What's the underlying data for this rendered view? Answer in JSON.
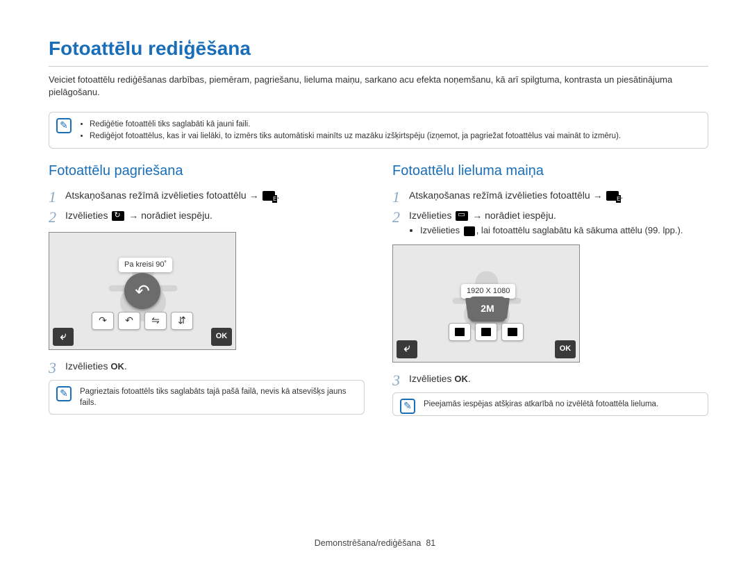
{
  "title": "Fotoattēlu rediģēšana",
  "intro": "Veiciet fotoattēlu rediģēšanas darbības, piemēram, pagriešanu, lieluma maiņu, sarkano acu efekta noņemšanu, kā arī spilgtuma, kontrasta un piesātinājuma pielāgošanu.",
  "top_notes": [
    "Rediģētie fotoattēli tiks saglabāti kā jauni faili.",
    "Rediģējot fotoattēlus, kas ir  vai lielāki, to izmērs tiks automātiski mainīts uz mazāku izšķirtspēju (izņemot, ja pagriežat fotoattēlus vai maināt to izmēru)."
  ],
  "left": {
    "heading": "Fotoattēlu pagriešana",
    "step1": "Atskaņošanas režīmā izvēlieties fotoattēlu →",
    "step2a": "Izvēlieties",
    "step2b": "→ norādiet iespēju.",
    "tooltip": "Pa kreisi 90˚",
    "ok_label": "OK",
    "step3a": "Izvēlieties",
    "step3b": ".",
    "note": "Pagrieztais fotoattēls tiks saglabāts tajā pašā failā, nevis kā atsevišķs jauns fails."
  },
  "right": {
    "heading": "Fotoattēlu lieluma maiņa",
    "step1": "Atskaņošanas režīmā izvēlieties fotoattēlu →",
    "step2a": "Izvēlieties",
    "step2b": "→ norādiet iespēju.",
    "bullet_a": "Izvēlieties",
    "bullet_b": ", lai fotoattēlu saglabātu kā sākuma attēlu (99. lpp.).",
    "tooltip": "1920 X 1080",
    "res_label": "2M",
    "ok_label": "OK",
    "step3a": "Izvēlieties",
    "step3b": ".",
    "note": "Pieejamās iespējas atšķiras atkarībā no izvēlētā fotoattēla lieluma."
  },
  "footer": {
    "section": "Demonstrēšana/rediģēšana",
    "page": "81"
  }
}
